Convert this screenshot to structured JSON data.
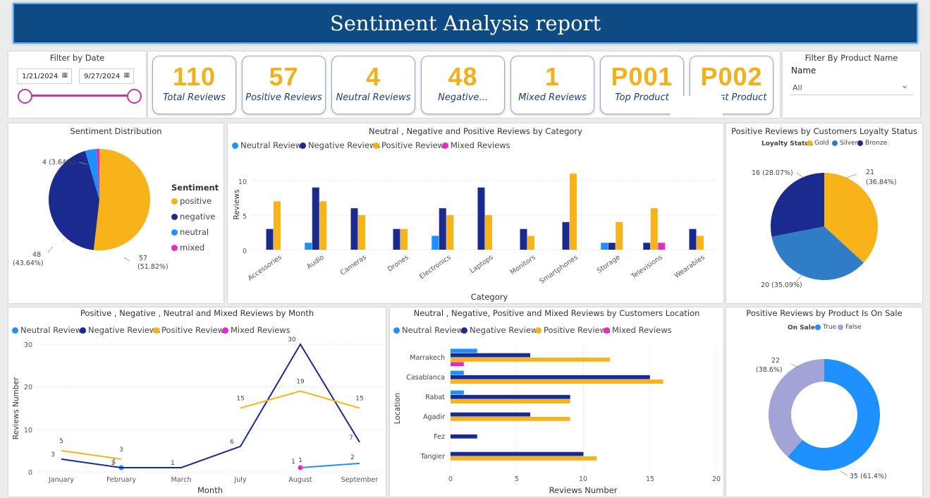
{
  "report": {
    "title": "Sentiment Analysis report"
  },
  "colors": {
    "neutral": "#1e90ff",
    "negative": "#1a2a8f",
    "positive": "#f9b31a",
    "mixed": "#e52bc6",
    "gold": "#f9b31a",
    "silver": "#2f7dc6",
    "bronze": "#1a2a8f",
    "true": "#1e90ff",
    "false": "#a3a3d6",
    "slider": "#c2389c"
  },
  "date_filter": {
    "title": "Filter by Date",
    "start": "1/21/2024",
    "end": "9/27/2024"
  },
  "kpis": [
    {
      "value": "110",
      "label": "Total Reviews"
    },
    {
      "value": "57",
      "label": "Positive Reviews"
    },
    {
      "value": "4",
      "label": "Neutral Reviews"
    },
    {
      "value": "48",
      "label": "Negative..."
    },
    {
      "value": "1",
      "label": "Mixed Reviews"
    },
    {
      "value": "P001",
      "label": "Top Product"
    },
    {
      "value": "P002",
      "label": "st Product"
    }
  ],
  "product_filter": {
    "title": "Filter By Product Name",
    "field_label": "Name",
    "selected": "All"
  },
  "sentiment_dist": {
    "title": "Sentiment Distribution",
    "legend_title": "Sentiment",
    "legend": [
      "positive",
      "negative",
      "neutral",
      "mixed"
    ],
    "labels": {
      "positive": "57",
      "positive_pct": "(51.82%)",
      "negative": "48",
      "negative_pct": "(43.64%)",
      "neutral": "4 (3.64%)"
    }
  },
  "category_chart": {
    "title": "Neutral , Negative and Positive Reviews by Category",
    "legend": [
      "Neutral Reviews",
      "Negative Reviews",
      "Positive Reviews",
      "Mixed Reviews"
    ],
    "xlabel": "Category",
    "ylabel": "Reviews",
    "yticks": [
      "0",
      "5",
      "10"
    ]
  },
  "loyalty_chart": {
    "title": "Positive Reviews by Customers Loyalty Status",
    "legend_title": "Loyalty Status",
    "legend": [
      "Gold",
      "Silver",
      "Bronze"
    ],
    "labels": {
      "gold": "21",
      "gold_pct": "(36.84%)",
      "silver": "20 (35.09%)",
      "bronze": "16 (28.07%)"
    }
  },
  "month_chart": {
    "title": "Positive , Negative , Neutral and Mixed Reviews by Month",
    "legend": [
      "Neutral Reviews",
      "Negative Reviews",
      "Positive Reviews",
      "Mixed Reviews"
    ],
    "xlabel": "Month",
    "ylabel": "Reviews Number",
    "yticks": [
      "0",
      "10",
      "20",
      "30"
    ]
  },
  "location_chart": {
    "title": "Neutral , Negative, Positive and Mixed Reviews by Customers Location",
    "legend": [
      "Neutral Reviews",
      "Negative Reviews",
      "Positive Reviews",
      "Mixed Reviews"
    ],
    "xlabel": "Reviews Number",
    "ylabel": "Location",
    "xticks": [
      "0",
      "5",
      "10",
      "15",
      "20"
    ]
  },
  "sale_chart": {
    "title": "Positive Reviews by Product Is On Sale",
    "legend_title": "On Sale",
    "legend": [
      "True",
      "False"
    ],
    "labels": {
      "true": "35 (61.4%)",
      "false": "22",
      "false_pct": "(38.6%)"
    }
  },
  "chart_data": [
    {
      "type": "pie",
      "title": "Sentiment Distribution",
      "categories": [
        "positive",
        "negative",
        "neutral",
        "mixed"
      ],
      "values": [
        57,
        48,
        4,
        1
      ]
    },
    {
      "type": "bar",
      "title": "Neutral , Negative and Positive Reviews by Category",
      "categories": [
        "Accessories",
        "Audio",
        "Cameras",
        "Drones",
        "Electronics",
        "Laptops",
        "Monitors",
        "Smartphones",
        "Storage",
        "Televisions",
        "Wearables"
      ],
      "series": [
        {
          "name": "Neutral Reviews",
          "values": [
            0,
            1,
            0,
            0,
            2,
            0,
            0,
            0,
            1,
            0,
            0
          ]
        },
        {
          "name": "Negative Reviews",
          "values": [
            3,
            9,
            6,
            3,
            6,
            9,
            3,
            4,
            1,
            1,
            3
          ]
        },
        {
          "name": "Positive Reviews",
          "values": [
            7,
            7,
            5,
            3,
            5,
            5,
            2,
            11,
            4,
            6,
            2
          ]
        },
        {
          "name": "Mixed Reviews",
          "values": [
            0,
            0,
            0,
            0,
            0,
            0,
            0,
            0,
            0,
            1,
            0
          ]
        }
      ],
      "xlabel": "Category",
      "ylabel": "Reviews",
      "ylim": [
        0,
        12
      ]
    },
    {
      "type": "pie",
      "title": "Positive Reviews by Customers Loyalty Status",
      "categories": [
        "Gold",
        "Silver",
        "Bronze"
      ],
      "values": [
        21,
        20,
        16
      ]
    },
    {
      "type": "line",
      "title": "Positive , Negative , Neutral and Mixed Reviews by Month",
      "categories": [
        "January",
        "February",
        "March",
        "July",
        "August",
        "September"
      ],
      "series": [
        {
          "name": "Neutral Reviews",
          "values": [
            null,
            1,
            null,
            null,
            1,
            2
          ]
        },
        {
          "name": "Negative Reviews",
          "values": [
            3,
            1,
            1,
            6,
            30,
            7
          ]
        },
        {
          "name": "Positive Reviews",
          "values": [
            5,
            3,
            null,
            15,
            19,
            15
          ]
        },
        {
          "name": "Mixed Reviews",
          "values": [
            null,
            null,
            null,
            null,
            1,
            null
          ]
        }
      ],
      "xlabel": "Month",
      "ylabel": "Reviews Number",
      "ylim": [
        0,
        30
      ]
    },
    {
      "type": "bar",
      "title": "Neutral , Negative, Positive and Mixed Reviews by Customers Location",
      "categories": [
        "Marrakech",
        "Casablanca",
        "Rabat",
        "Agadir",
        "Fez",
        "Tangier"
      ],
      "series": [
        {
          "name": "Neutral Reviews",
          "values": [
            2,
            1,
            1,
            0,
            0,
            0
          ]
        },
        {
          "name": "Negative Reviews",
          "values": [
            6,
            15,
            9,
            6,
            2,
            10
          ]
        },
        {
          "name": "Positive Reviews",
          "values": [
            12,
            16,
            9,
            9,
            0,
            11
          ]
        },
        {
          "name": "Mixed Reviews",
          "values": [
            1,
            0,
            0,
            0,
            0,
            0
          ]
        }
      ],
      "xlabel": "Reviews Number",
      "ylabel": "Location",
      "xlim": [
        0,
        20
      ]
    },
    {
      "type": "pie",
      "title": "Positive Reviews by Product Is On Sale",
      "categories": [
        "True",
        "False"
      ],
      "values": [
        35,
        22
      ]
    }
  ]
}
